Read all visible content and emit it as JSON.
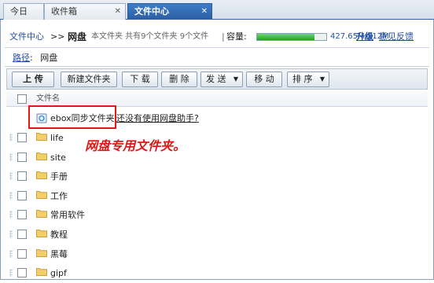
{
  "tabs": [
    {
      "label": "今日",
      "active": false
    },
    {
      "label": "收件箱",
      "active": false
    },
    {
      "label": "文件中心",
      "active": true
    }
  ],
  "header": {
    "breadcrumb_root": "文件中心",
    "separator": ">>",
    "title": "网盘",
    "summary": "本文件夹 共有9个文件夹 9个文件",
    "quota_label": "容量:",
    "quota_used_fraction": 0.834,
    "quota_text": "427.65M/512M",
    "upgrade": "升级",
    "feedback": "意见反馈"
  },
  "path": {
    "label": "路径",
    "colon": ":",
    "current": "网盘"
  },
  "toolbar": {
    "upload": "上 传",
    "new_folder": "新建文件夹",
    "download": "下 载",
    "delete": "删 除",
    "send": "发 送",
    "move": "移 动",
    "sort": "排 序"
  },
  "list": {
    "column_name": "文件名",
    "special_folder": {
      "name": "ebox同步文件夹",
      "hint": "还没有使用网盘助手?"
    },
    "folders": [
      "life",
      "site",
      "手册",
      "工作",
      "常用软件",
      "教程",
      "黑莓",
      "gipf"
    ]
  },
  "annotation": "网盘专用文件夹。",
  "colors": {
    "accent": "#2a5ea3",
    "link": "#1f4fa3",
    "quota_fill": "#1fa51f",
    "highlight": "#e01818"
  }
}
